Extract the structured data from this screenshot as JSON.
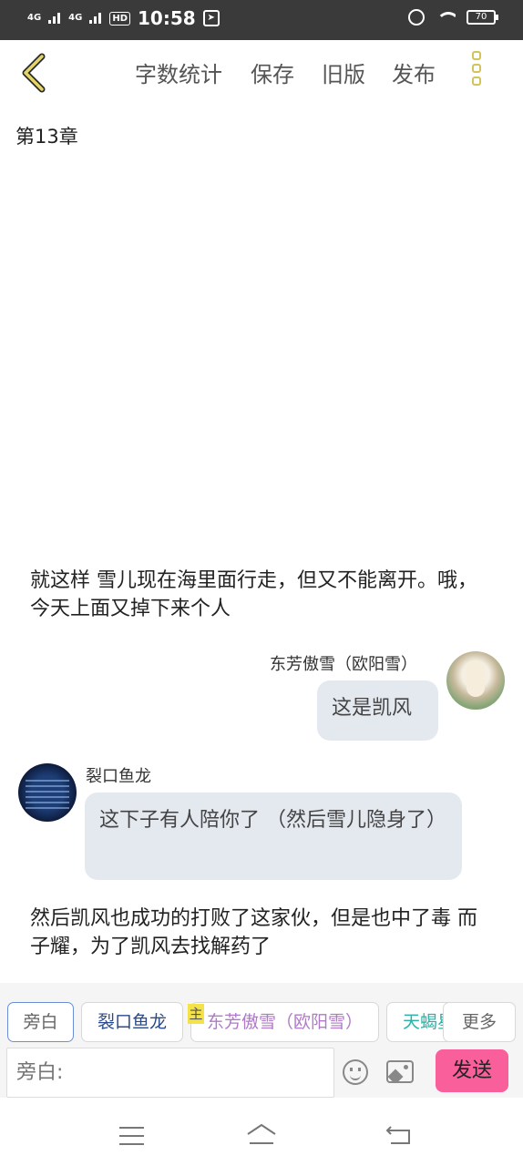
{
  "status_bar": {
    "net1": "4G",
    "net2": "4G",
    "hd": "HD",
    "time": "10:58",
    "battery": "70"
  },
  "header": {
    "menu": [
      "字数统计",
      "保存",
      "旧版",
      "发布"
    ]
  },
  "chapter_title": "第13章",
  "messages": {
    "narration1": "就这样 雪儿现在海里面行走，但又不能离开。哦，今天上面又掉下来个人",
    "right_name": "东芳傲雪（欧阳雪）",
    "right_text": "这是凯风",
    "left_name": "裂口鱼龙",
    "left_text": "这下子有人陪你了 （然后雪儿隐身了）",
    "narration2": "然后凯风也成功的打败了这家伙，但是也中了毒 而子耀，为了凯风去找解药了"
  },
  "toolbar": {
    "chips": [
      "旁白",
      "裂口鱼龙",
      "东芳傲雪（欧阳雪）",
      "天蝎星"
    ],
    "more": "更多",
    "tag": "主",
    "input_placeholder": "旁白:",
    "send": "发送"
  },
  "colors": {
    "chip_blue": "#2b4a8a",
    "chip_purple": "#b07ac8",
    "chip_teal": "#29b3a8",
    "send_bg": "#f95f9a",
    "accent_yellow": "#d3c35b"
  }
}
